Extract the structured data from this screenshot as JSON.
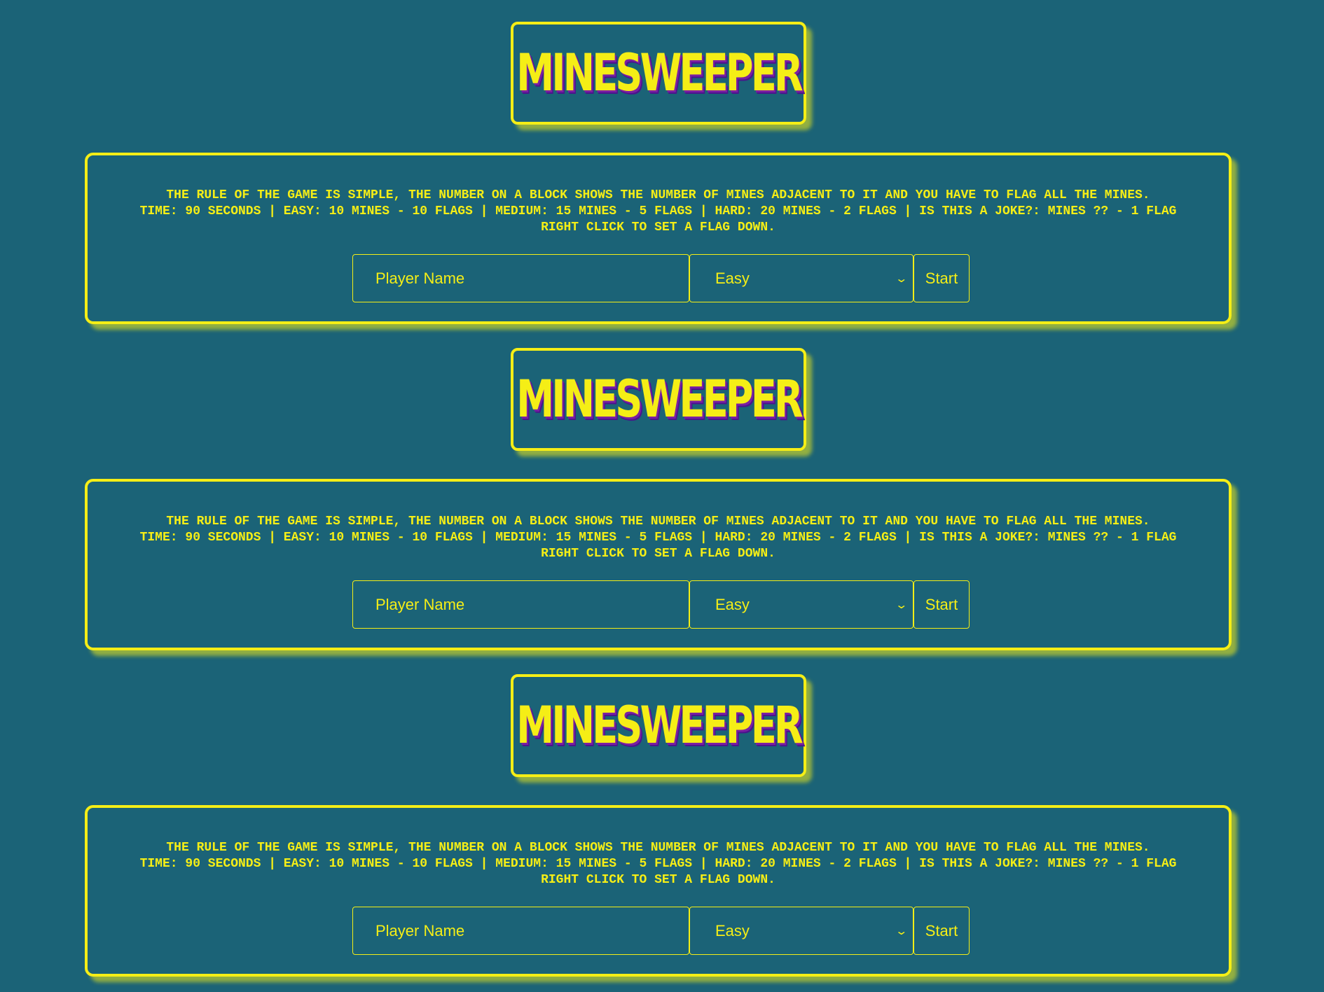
{
  "title": "MINESWEEPER",
  "rules": {
    "line1": "THE RULE OF THE GAME IS SIMPLE, THE NUMBER ON A BLOCK SHOWS THE NUMBER OF MINES ADJACENT TO IT AND YOU HAVE TO FLAG ALL THE MINES.",
    "line2": "TIME: 90 SECONDS | EASY: 10 MINES - 10 FLAGS | MEDIUM: 15 MINES - 5 FLAGS | HARD: 20 MINES - 2 FLAGS | IS THIS A JOKE?: MINES ?? - 1 FLAG",
    "line3": "RIGHT CLICK TO SET A FLAG DOWN."
  },
  "form": {
    "name_placeholder": "Player Name",
    "name_value": "",
    "difficulty_selected": "Easy",
    "start_label": "Start"
  },
  "colors": {
    "background": "#1b6377",
    "accent": "#f5ee16",
    "title_shadow": "#7b1fa2"
  },
  "icons": {
    "select_arrow": "chevron-down-icon"
  }
}
